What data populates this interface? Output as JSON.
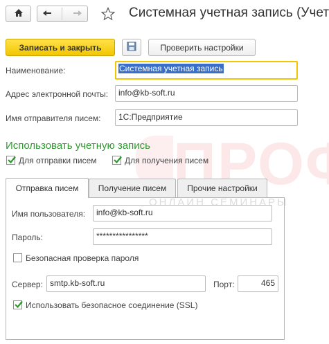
{
  "title": "Системная учетная запись (Учетн",
  "toolbar": {
    "save_close_label": "Записать и закрыть",
    "check_settings_label": "Проверить настройки"
  },
  "form": {
    "name_label": "Наименование:",
    "name_value": "Системная учетная запись",
    "email_label": "Адрес электронной почты:",
    "email_value": "info@kb-soft.ru",
    "sender_label": "Имя отправителя писем:",
    "sender_value": "1С:Предприятие"
  },
  "use_account": {
    "title": "Использовать учетную запись",
    "send_label": "Для отправки писем",
    "send_checked": true,
    "receive_label": "Для получения писем",
    "receive_checked": true
  },
  "tabs": [
    {
      "label": "Отправка писем",
      "active": true
    },
    {
      "label": "Получение писем",
      "active": false
    },
    {
      "label": "Прочие настройки",
      "active": false
    }
  ],
  "sending": {
    "user_label": "Имя пользователя:",
    "user_value": "info@kb-soft.ru",
    "password_label": "Пароль:",
    "password_value": "****************",
    "secure_password_label": "Безопасная проверка пароля",
    "secure_password_checked": false,
    "server_label": "Сервер:",
    "server_value": "smtp.kb-soft.ru",
    "port_label": "Порт:",
    "port_value": "465",
    "ssl_label": "Использовать безопасное соединение (SSL)",
    "ssl_checked": true
  },
  "watermark": {
    "logo_text": "ПРОФ",
    "sub_text": "ОНЛАЙН СЕМИНАРЫ"
  },
  "colors": {
    "accent_yellow": "#f2c600",
    "section_green": "#2e9a2e",
    "check_green": "#2e9a2e",
    "watermark_red": "#e52d2d",
    "selection_blue": "#3a6fc8"
  },
  "icons": {
    "home": "home-icon",
    "back": "arrow-left-icon",
    "forward": "arrow-right-icon",
    "favorite": "star-icon",
    "save": "floppy-disk-icon"
  }
}
